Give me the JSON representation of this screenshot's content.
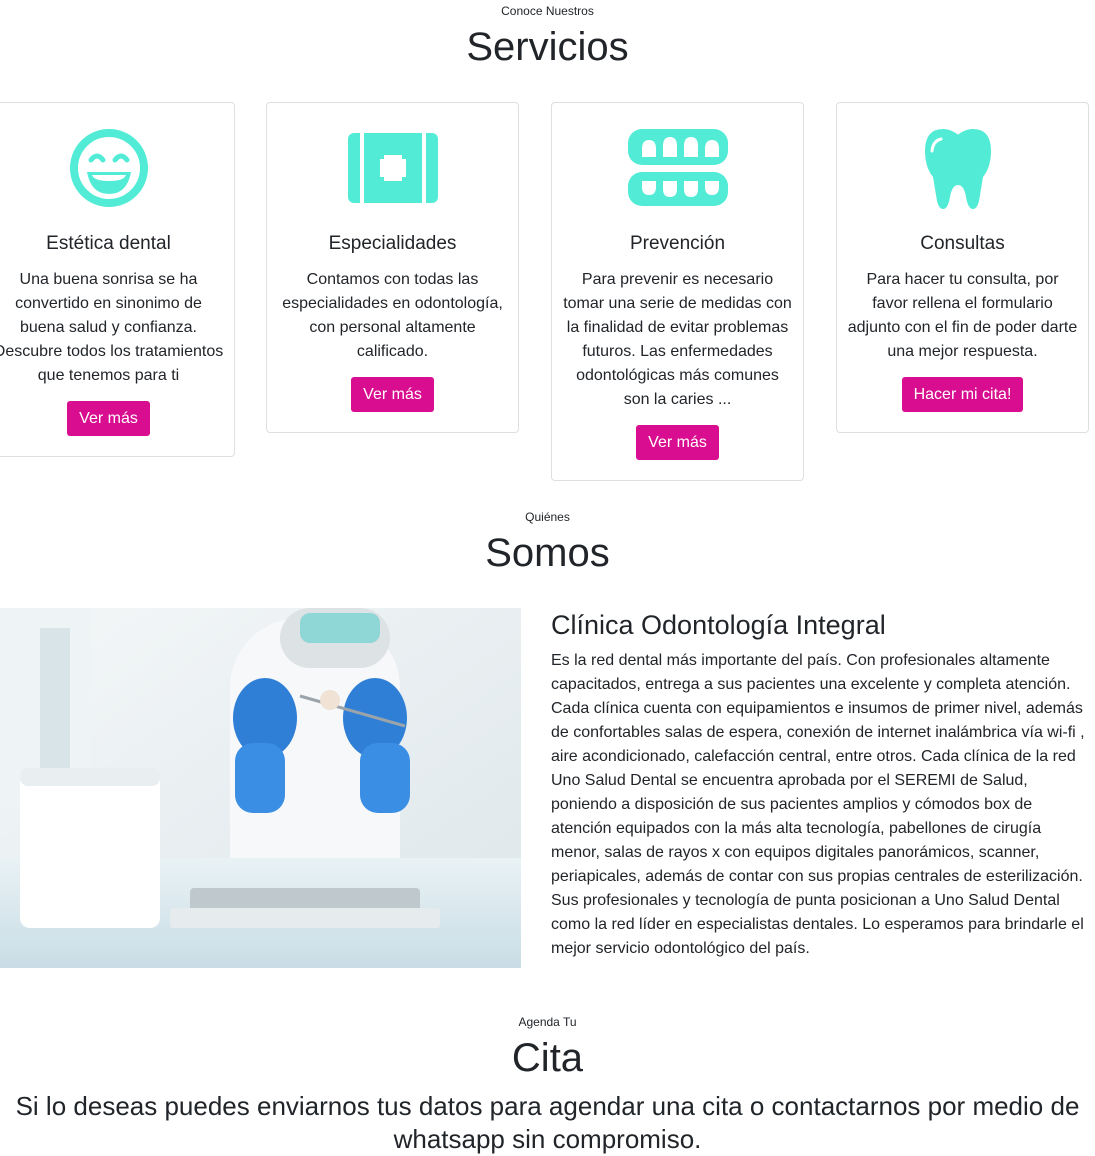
{
  "services": {
    "kicker": "Conoce Nuestros",
    "title": "Servicios",
    "cards": [
      {
        "icon": "smile-icon",
        "title": "Estética dental",
        "text": "Una buena sonrisa se ha convertido en sinonimo de buena salud y confianza. Descubre todos los tratamientos que tenemos para ti",
        "button": "Ver más"
      },
      {
        "icon": "medical-kit-icon",
        "title": "Especialidades",
        "text": "Contamos con todas las especialidades en odontología, con personal altamente calificado.",
        "button": "Ver más"
      },
      {
        "icon": "teeth-icon",
        "title": "Prevención",
        "text": "Para prevenir es necesario tomar una serie de medidas con la finalidad de evitar problemas futuros. Las enfermedades odontológicas más comunes son la caries ...",
        "button": "Ver más"
      },
      {
        "icon": "tooth-icon",
        "title": "Consultas",
        "text": "Para hacer tu consulta, por favor rellena el formulario adjunto con el fin de poder darte una mejor respuesta.",
        "button": "Hacer mi cita!"
      }
    ]
  },
  "about": {
    "kicker": "Quiénes",
    "title": "Somos",
    "heading": "Clínica Odontología Integral",
    "text": "Es la red dental más importante del país. Con profesionales altamente capacitados, entrega a sus pacientes una excelente y completa atención. Cada clínica cuenta con equipamientos e insumos de primer nivel, además de confortables salas de espera, conexión de internet inalámbrica vía wi-fi , aire acondicionado, calefacción central, entre otros. Cada clínica de la red Uno Salud Dental se encuentra aprobada por el SEREMI de Salud, poniendo a disposición de sus pacientes amplios y cómodos box de atención equipados con la más alta tecnología, pabellones de cirugía menor, salas de rayos x con equipos digitales panorámicos, scanner, periapicales, además de contar con sus propias centrales de esterilización. Sus profesionales y tecnología de punta posicionan a Uno Salud Dental como la red líder en especialistas dentales. Lo esperamos para brindarle el mejor servicio odontológico del país."
  },
  "appointment": {
    "kicker": "Agenda Tu",
    "title": "Cita",
    "message": "Si lo deseas puedes enviarnos tus datos para agendar una cita o contactarnos por medio de whatsapp sin compromiso."
  },
  "colors": {
    "accent_icon": "#52ecd6",
    "button": "#d80d8f",
    "text": "#212529"
  }
}
